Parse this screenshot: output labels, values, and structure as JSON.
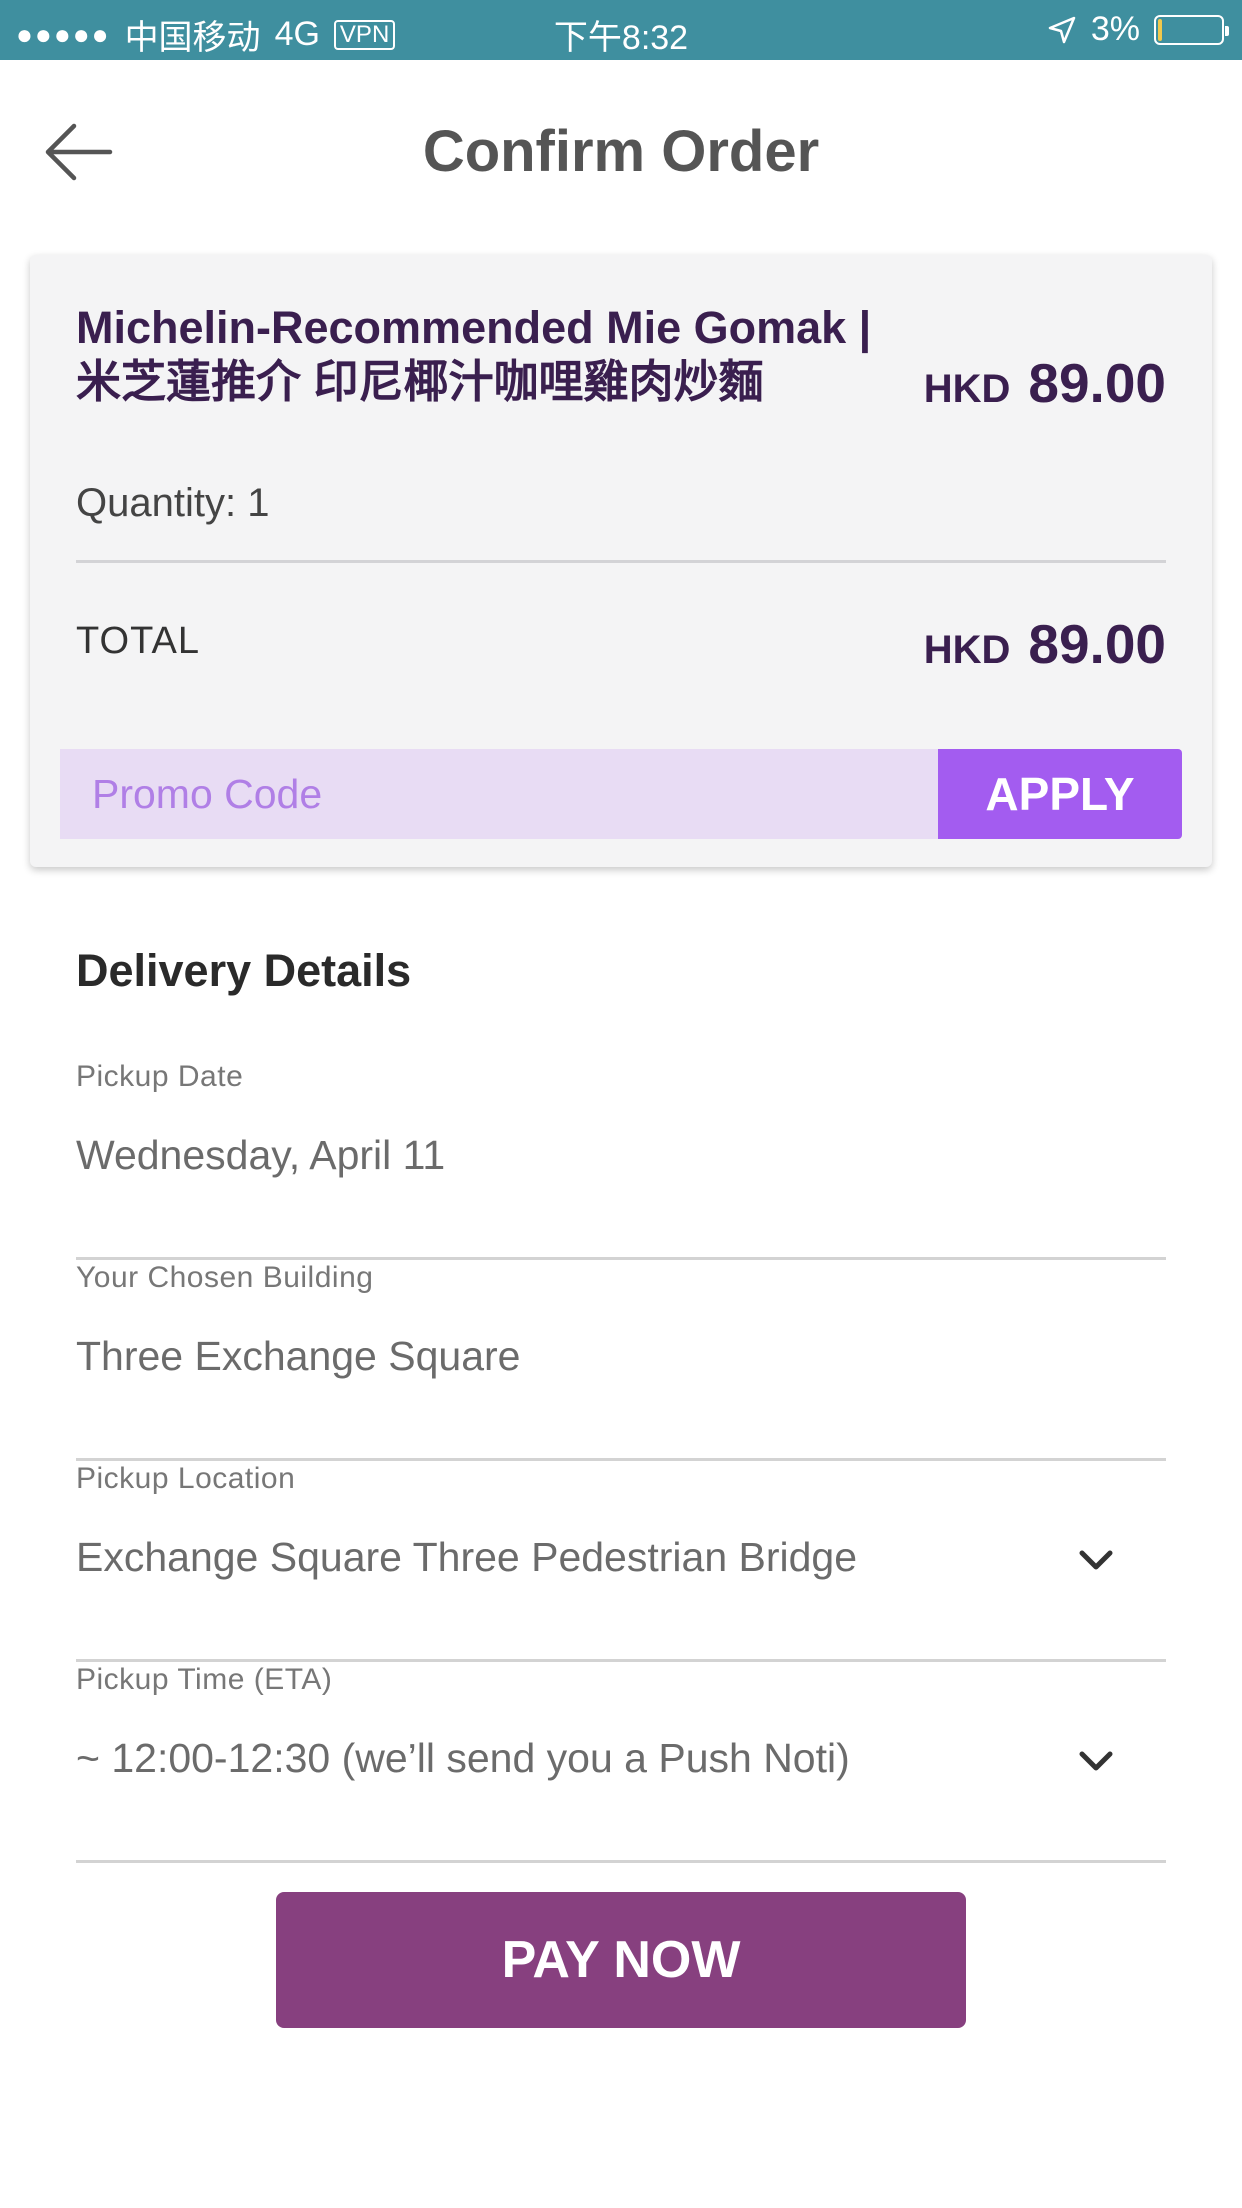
{
  "status_bar": {
    "signal_dots": "●●●●●",
    "carrier": "中国移动",
    "network": "4G",
    "vpn": "VPN",
    "time": "下午8:32",
    "battery_percent": "3%",
    "battery_level": 0.03,
    "battery_color": "#f2c94c"
  },
  "header": {
    "title": "Confirm Order",
    "back_icon": "arrow-left-icon"
  },
  "order": {
    "item_name": "Michelin-Recommended Mie Gomak | 米芝蓮推介 印尼椰汁咖哩雞肉炒麵",
    "quantity": "Quantity: 1",
    "item_currency": "HKD",
    "item_amount": "89.00",
    "total_label": "TOTAL",
    "total_currency": "HKD",
    "total_amount": "89.00",
    "promo_placeholder": "Promo Code",
    "apply_label": "APPLY"
  },
  "delivery": {
    "title": "Delivery Details",
    "fields": [
      {
        "label": "Pickup Date",
        "value": "Wednesday, April 11"
      },
      {
        "label": "Your Chosen Building",
        "value": "Three Exchange Square"
      },
      {
        "label": "Pickup Location",
        "value": "Exchange Square Three Pedestrian Bridge",
        "icon": "chevron-down-icon"
      },
      {
        "label": "Pickup Time (ETA)",
        "value": "~ 12:00-12:30 (we’ll send you a Push Noti)",
        "icon": "chevron-down-icon"
      }
    ]
  },
  "pay_label": "PAY NOW",
  "colors": {
    "status_bar": "#3f8f9f",
    "title_text": "#3a1f4f",
    "promo_bg": "#e8dcf4",
    "apply_bg": "#a35cf0",
    "pay_bg": "#87407f"
  }
}
